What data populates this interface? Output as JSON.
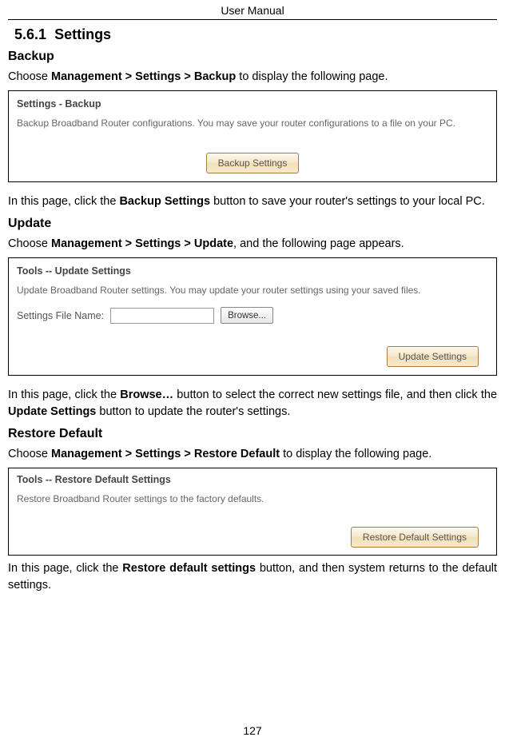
{
  "header": "User Manual",
  "section": {
    "number": "5.6.1",
    "title": "Settings"
  },
  "backup": {
    "title": "Backup",
    "intro_pre": "Choose ",
    "intro_bold": "Management > Settings > Backup",
    "intro_post": " to display the following page.",
    "ss_title": "Settings - Backup",
    "ss_desc": "Backup Broadband Router configurations. You may save your router configurations to a file on your PC.",
    "button_label": "Backup Settings",
    "outro_pre": "In this page, click the ",
    "outro_bold": "Backup Settings",
    "outro_post": " button to save your router's settings to your local PC."
  },
  "update": {
    "title": "Update",
    "intro_pre": "Choose ",
    "intro_bold": "Management > Settings > Update",
    "intro_post": ", and the following page appears.",
    "ss_title": "Tools -- Update Settings",
    "ss_desc": "Update Broadband Router settings. You may update your router settings using your saved files.",
    "file_label": "Settings File Name:",
    "browse_label": "Browse...",
    "button_label": "Update Settings",
    "outro_pre": "In this page, click the ",
    "outro_bold1": "Browse…",
    "outro_mid": " button to select the correct new settings file, and then click the ",
    "outro_bold2": "Update Settings",
    "outro_post": " button to update the router's settings."
  },
  "restore": {
    "title": "Restore Default",
    "intro_pre": "Choose ",
    "intro_bold": "Management > Settings > Restore Default",
    "intro_post": " to display the following page.",
    "ss_title": "Tools -- Restore Default Settings",
    "ss_desc": "Restore Broadband Router settings to the factory defaults.",
    "button_label": "Restore Default Settings",
    "outro_pre": "In this page, click the ",
    "outro_bold": "Restore default settings",
    "outro_post": " button, and then system returns to the default settings."
  },
  "page_number": "127"
}
